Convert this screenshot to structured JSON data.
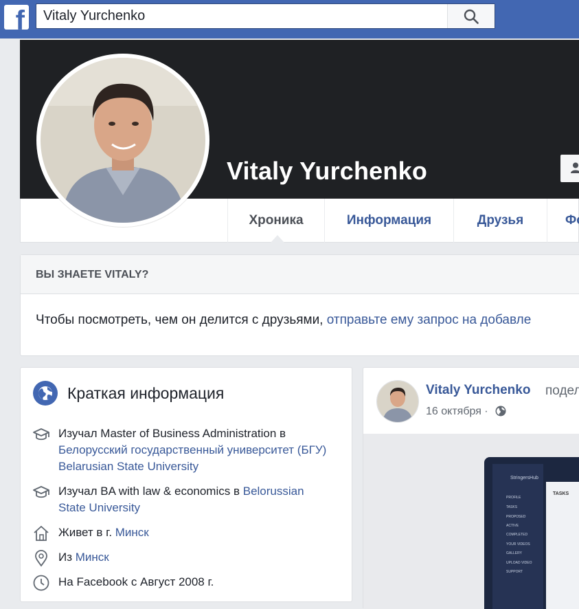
{
  "topbar": {
    "logo_letter": "f",
    "search_value": "Vitaly Yurchenko",
    "search_icon": "search-icon"
  },
  "profile": {
    "name": "Vitaly Yurchenko",
    "tabs": [
      {
        "label": "Хроника",
        "active": true
      },
      {
        "label": "Информация"
      },
      {
        "label": "Друзья"
      },
      {
        "label": "Фо"
      }
    ]
  },
  "know": {
    "title": "ВЫ ЗНАЕТЕ VITALY?",
    "text": "Чтобы посмотреть, чем он делится с друзьями, ",
    "link": "отправьте ему запрос на добавле"
  },
  "intro": {
    "title": "Краткая информация",
    "rows": [
      {
        "icon": "graduation-cap-icon",
        "text": "Изучал Master of Business Administration в ",
        "link": "Белорусский государственный университет (БГУ) Belarusian State University"
      },
      {
        "icon": "graduation-cap-icon",
        "text": "Изучал BA with law & economics в ",
        "link": "Belorussian State University"
      },
      {
        "icon": "home-icon",
        "text": "Живет в г. ",
        "link": "Минск"
      },
      {
        "icon": "location-pin-icon",
        "text": "Из ",
        "link": "Минск"
      },
      {
        "icon": "clock-icon",
        "text": "На Facebook с Август 2008 г.",
        "link": ""
      }
    ]
  },
  "post": {
    "author": "Vitaly Yurchenko",
    "action": "подел",
    "date": "16 октября ·",
    "privacy_icon": "globe-icon",
    "screen": {
      "logo": "StringersHub",
      "heading": "TASKS",
      "menu": [
        "PROFILE",
        "TASKS",
        "PROPOSED",
        "ACTIVE",
        "COMPLETED",
        "YOUR VIDEOS",
        "GALLERY",
        "UPLOAD VIDEO",
        "SUPPORT"
      ]
    }
  },
  "colors": {
    "brand": "#4267b2",
    "link": "#385898",
    "page_bg": "#e9ebee"
  }
}
